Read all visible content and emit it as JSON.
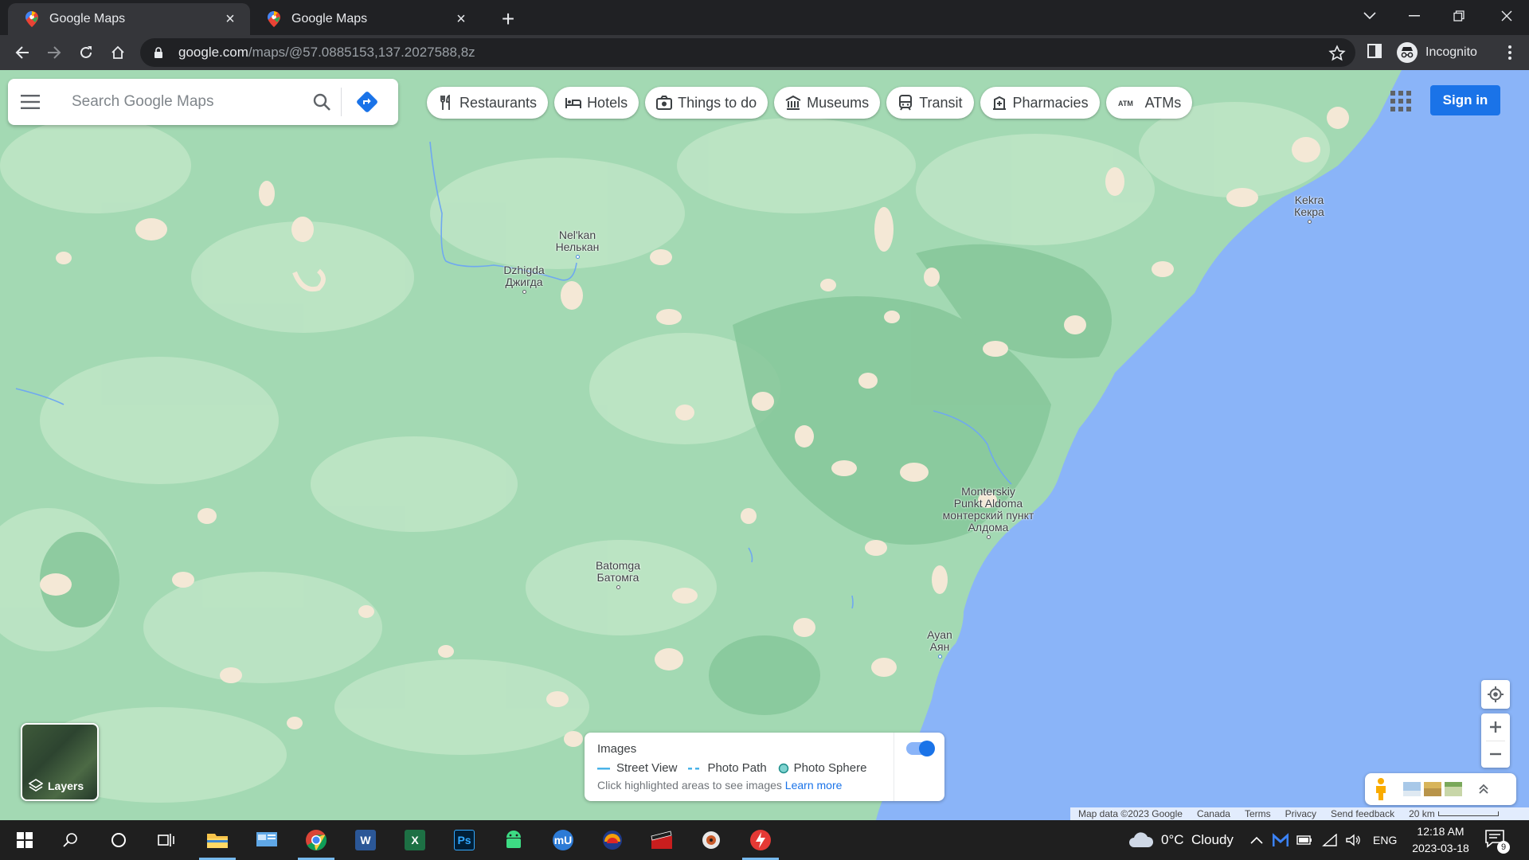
{
  "browser": {
    "tabs": [
      {
        "title": "Google Maps",
        "active": true
      },
      {
        "title": "Google Maps",
        "active": false
      }
    ],
    "url_host": "google.com",
    "url_path": "/maps/@57.0885153,137.2027588,8z",
    "profile_label": "Incognito"
  },
  "maps": {
    "search_placeholder": "Search Google Maps",
    "chips": [
      {
        "label": "Restaurants",
        "icon": "fork-knife-icon"
      },
      {
        "label": "Hotels",
        "icon": "bed-icon"
      },
      {
        "label": "Things to do",
        "icon": "camera-icon"
      },
      {
        "label": "Museums",
        "icon": "museum-icon"
      },
      {
        "label": "Transit",
        "icon": "train-icon"
      },
      {
        "label": "Pharmacies",
        "icon": "pharmacy-icon"
      },
      {
        "label": "ATMs",
        "icon": "atm-icon"
      }
    ],
    "sign_in_label": "Sign in",
    "places": [
      {
        "name": "Nel'kan",
        "native": "Нелькан"
      },
      {
        "name": "Dzhigda",
        "native": "Джигда"
      },
      {
        "name": "Kekra",
        "native": "Кекра"
      },
      {
        "name": "Monterskiy Punkt Aldoma",
        "native": "монтерский пункт Алдома"
      },
      {
        "name": "Batomga",
        "native": "Батомга"
      },
      {
        "name": "Ayan",
        "native": "Аян"
      }
    ],
    "layers_label": "Layers",
    "images_panel": {
      "title": "Images",
      "street_view": "Street View",
      "photo_path": "Photo Path",
      "photo_sphere": "Photo Sphere",
      "hint": "Click highlighted areas to see images",
      "learn_more": "Learn more",
      "toggle_on": true
    },
    "attribution": {
      "map_data": "Map data ©2023 Google",
      "country": "Canada",
      "terms": "Terms",
      "privacy": "Privacy",
      "feedback": "Send feedback",
      "scale": "20 km"
    }
  },
  "taskbar": {
    "weather": "0°C  Cloudy",
    "language": "ENG",
    "time": "12:18 AM",
    "date": "2023-03-18",
    "notifications": "9"
  }
}
